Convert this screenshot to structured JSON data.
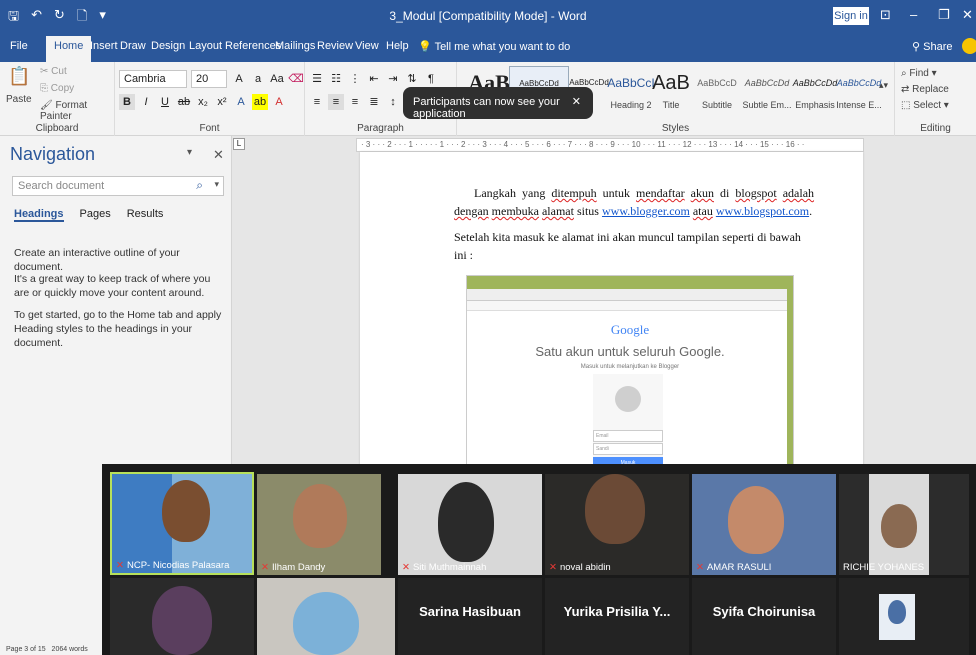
{
  "window": {
    "title": "3_Modul [Compatibility Mode]  -  Word",
    "sign_in": "Sign in"
  },
  "tabs": [
    "File",
    "Home",
    "Insert",
    "Draw",
    "Design",
    "Layout",
    "References",
    "Mailings",
    "Review",
    "View",
    "Help"
  ],
  "tell_me": "Tell me what you want to do",
  "share": "Share",
  "ribbon": {
    "clipboard": {
      "label": "Clipboard",
      "paste": "Paste",
      "cut": "Cut",
      "copy": "Copy",
      "format_painter": "Format Painter"
    },
    "font": {
      "label": "Font",
      "name": "Cambria",
      "size": "20"
    },
    "paragraph": {
      "label": "Paragraph"
    },
    "styles": {
      "label": "Styles",
      "items": [
        {
          "sample": "AaB",
          "name": ""
        },
        {
          "sample": "AaBbCcDd",
          "name": ""
        },
        {
          "sample": "AaBbCcDd",
          "name": ""
        },
        {
          "sample": "AaBbCcI",
          "name": "Heading 2"
        },
        {
          "sample": "AaB",
          "name": "Title"
        },
        {
          "sample": "AaBbCcD",
          "name": "Subtitle"
        },
        {
          "sample": "AaBbCcDd",
          "name": "Subtle Em..."
        },
        {
          "sample": "AaBbCcDd",
          "name": "Emphasis"
        },
        {
          "sample": "AaBbCcDd",
          "name": "Intense E..."
        }
      ]
    },
    "editing": {
      "label": "Editing",
      "find": "Find",
      "replace": "Replace",
      "select": "Select"
    }
  },
  "toast": {
    "message": "Participants can now see your application"
  },
  "navigation": {
    "title": "Navigation",
    "search_placeholder": "Search document",
    "tabs": [
      "Headings",
      "Pages",
      "Results"
    ],
    "help": [
      "Create an interactive outline of your document.",
      "It's a great way to keep track of where you are or quickly move your content around.",
      "To get started, go to the Home tab and apply Heading styles to the headings in your document."
    ]
  },
  "ruler_text": "· 3 · · · 2 · · · 1 · · · · · 1 · · · 2 · · · 3 · · · 4 · · · 5 · · · 6 · · · 7 · · · 8 · · · 9 · · · 10 · · · 11 · · · 12 · · · 13 · · · 14 · · · 15 · · · 16 · ·",
  "document": {
    "para1_a": "Langkah yang ",
    "para1_b": "ditempuh",
    "para1_c": " untuk ",
    "para1_d": "mendaftar",
    "para1_e": " ",
    "para1_f": "akun",
    "para1_g": " di ",
    "para1_h": "blogspot",
    "para1_i": " ",
    "para1_j": "adalah",
    "para1_k": " ",
    "para1_l": "dengan",
    "para1_m": "membuka",
    "para1_n": " ",
    "para1_o": "alamat",
    "para1_p": " situs ",
    "link1": "www.blogger.com",
    "para1_q": " ",
    "para1_r": "atau",
    "para1_s": " ",
    "link2": "www.blogspot.com",
    "para1_t": ".",
    "para2": "Setelah kita masuk ke alamat ini akan muncul tampilan seperti di bawah ini :",
    "embed": {
      "logo": "Google",
      "title": "Satu akun untuk seluruh Google.",
      "subtitle": "Masuk untuk melanjutkan ke Blogger",
      "email": "Email",
      "password": "Sandi",
      "button": "Masuk"
    }
  },
  "participants": {
    "row1": [
      "NCP- Nicodias Palasara",
      "Ilham Dandy",
      "Siti Muthmainnah",
      "noval abidin",
      "AMAR RASULI",
      "RICHIE YOHANES"
    ],
    "row2": [
      "Sarina Hasibuan",
      "Yurika Prisilia Y...",
      "Syifa Choirunisa"
    ]
  },
  "status": {
    "page": "Page 3 of 15",
    "words": "2064 words"
  },
  "colors": {
    "word_blue": "#2b579a",
    "toast": "#2f2f2f",
    "video_bg": "#1a1a1a"
  }
}
